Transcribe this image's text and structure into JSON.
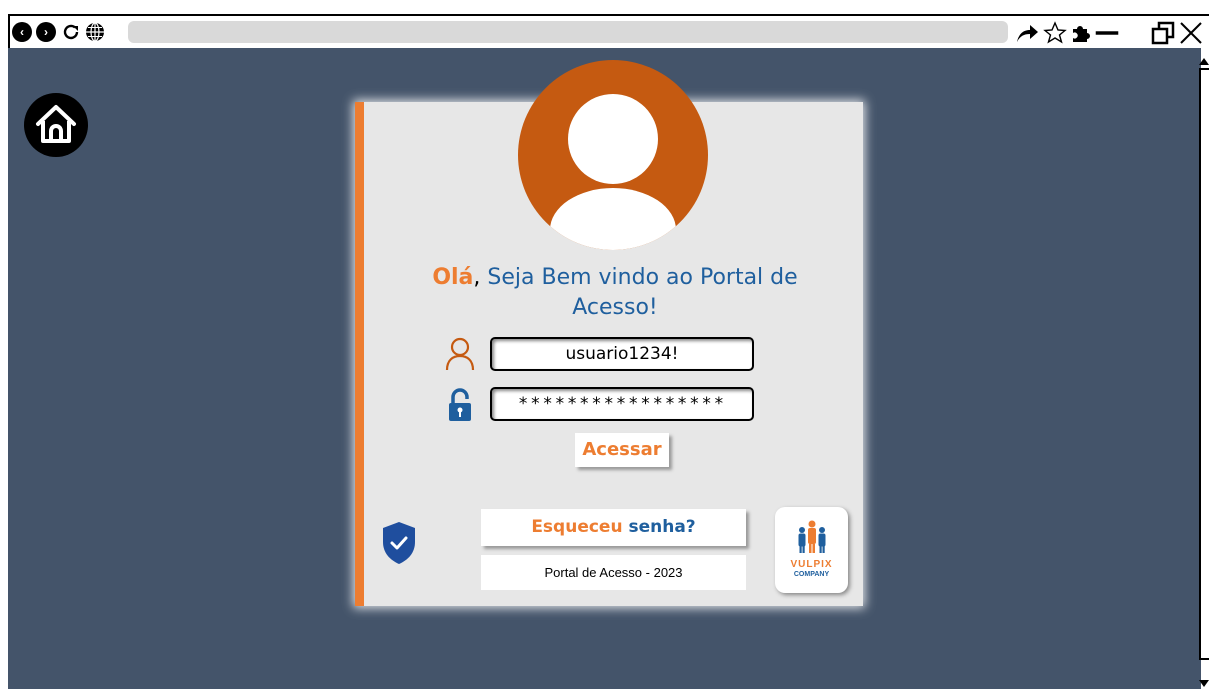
{
  "browser": {
    "back_icon": "back-arrow-icon",
    "forward_icon": "forward-arrow-icon",
    "reload_icon": "reload-icon",
    "globe_icon": "globe-icon",
    "address_value": "",
    "share_icon": "share-icon",
    "star_icon": "star-icon",
    "extensions_icon": "puzzle-icon",
    "minimize_icon": "minimize-icon",
    "restore_icon": "restore-icon",
    "close_icon": "close-icon"
  },
  "page": {
    "background_color": "#44546a",
    "home_icon": "home-icon"
  },
  "login": {
    "greeting_highlight": "Olá",
    "greeting_comma": ",",
    "greeting_rest": " Seja Bem vindo ao Portal de Acesso!",
    "username_value": "usuario1234!",
    "password_value": "*****************",
    "submit_label": "Acessar",
    "forgot_word1": "Esqueceu",
    "forgot_word2": " senha?",
    "footer_text": "Portal de Acesso - 2023",
    "logo_name": "VULPIX",
    "logo_sub": "COMPANY",
    "accent_color": "#ed7d31",
    "primary_color": "#1f5f9e"
  }
}
